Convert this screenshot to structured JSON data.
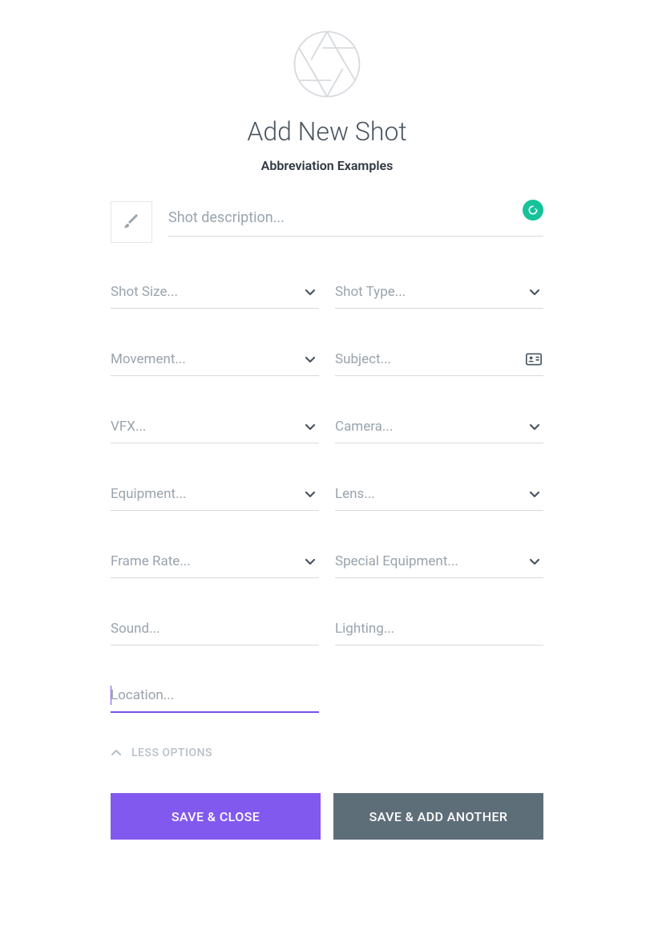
{
  "header": {
    "title": "Add New Shot",
    "subtitle": "Abbreviation Examples"
  },
  "description": {
    "placeholder": "Shot description..."
  },
  "fields": {
    "shot_size": {
      "placeholder": "Shot Size..."
    },
    "shot_type": {
      "placeholder": "Shot Type..."
    },
    "movement": {
      "placeholder": "Movement..."
    },
    "subject": {
      "placeholder": "Subject..."
    },
    "vfx": {
      "placeholder": "VFX..."
    },
    "camera": {
      "placeholder": "Camera..."
    },
    "equipment": {
      "placeholder": "Equipment..."
    },
    "lens": {
      "placeholder": "Lens..."
    },
    "frame_rate": {
      "placeholder": "Frame Rate..."
    },
    "special_equipment": {
      "placeholder": "Special Equipment..."
    },
    "sound": {
      "placeholder": "Sound..."
    },
    "lighting": {
      "placeholder": "Lighting..."
    },
    "location": {
      "placeholder": "Location..."
    }
  },
  "toggle": {
    "less_options": "LESS OPTIONS"
  },
  "buttons": {
    "save_close": "SAVE & CLOSE",
    "save_add": "SAVE & ADD ANOTHER"
  }
}
